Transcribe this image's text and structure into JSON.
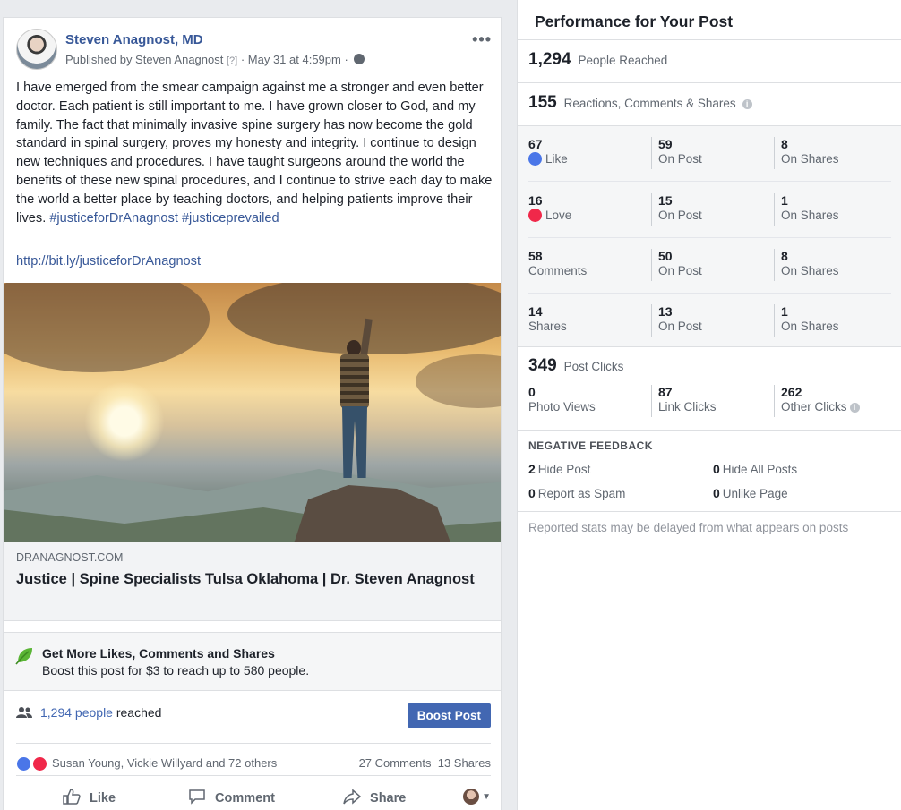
{
  "post": {
    "author": "Steven Anagnost, MD",
    "published_prefix": "Published by Steven Anagnost",
    "published_help": "[?]",
    "published_date": "· May 31 at 4:59pm ·",
    "more_label": "•••",
    "body": "I have emerged from the smear campaign against me a stronger and even better doctor. Each patient is still important to me. I have grown closer to God, and my family. The fact that minimally invasive spine surgery has now become the gold standard in spinal surgery, proves my honesty and integrity. I continue to design new techniques and procedures. I have taught surgeons around the world the benefits of these new spinal procedures, and I continue to strive each day to make the world a better place by teaching doctors, and helping patients improve their lives.",
    "hashtags": "#justiceforDrAnagnost #justiceprevailed",
    "link_url": "http://bit.ly/justiceforDrAnagnost",
    "link_domain": "DRANAGNOST.COM",
    "link_title": "Justice | Spine Specialists Tulsa Oklahoma | Dr. Steven Anagnost",
    "boost_title": "Get More Likes, Comments and Shares",
    "boost_sub": "Boost this post for $3 to reach up to 580 people.",
    "reach_count": "1,294 people",
    "reach_suffix": "reached",
    "boost_button": "Boost Post",
    "reaction_names": "Susan Young, Vickie Willyard and 72 others",
    "comments_count": "27 Comments",
    "shares_count": "13 Shares",
    "actions": {
      "like": "Like",
      "comment": "Comment",
      "share": "Share"
    }
  },
  "panel": {
    "title": "Performance for Your Post",
    "people_reached": {
      "num": "1,294",
      "label": "People Reached"
    },
    "engagement": {
      "num": "155",
      "label": "Reactions, Comments & Shares"
    },
    "rows": [
      {
        "n1": "67",
        "l1": "Like",
        "n2": "59",
        "l2": "On Post",
        "n3": "8",
        "l3": "On Shares"
      },
      {
        "n1": "16",
        "l1": "Love",
        "n2": "15",
        "l2": "On Post",
        "n3": "1",
        "l3": "On Shares"
      },
      {
        "n1": "58",
        "l1": "Comments",
        "n2": "50",
        "l2": "On Post",
        "n3": "8",
        "l3": "On Shares"
      },
      {
        "n1": "14",
        "l1": "Shares",
        "n2": "13",
        "l2": "On Post",
        "n3": "1",
        "l3": "On Shares"
      }
    ],
    "post_clicks": {
      "num": "349",
      "label": "Post Clicks"
    },
    "clicks": [
      {
        "n": "0",
        "l": "Photo Views"
      },
      {
        "n": "87",
        "l": "Link Clicks"
      },
      {
        "n": "262",
        "l": "Other Clicks"
      }
    ],
    "negative_title": "NEGATIVE FEEDBACK",
    "negative": [
      {
        "n": "2",
        "l": "Hide Post"
      },
      {
        "n": "0",
        "l": "Hide All Posts"
      },
      {
        "n": "0",
        "l": "Report as Spam"
      },
      {
        "n": "0",
        "l": "Unlike Page"
      }
    ],
    "footnote": "Reported stats may be delayed from what appears on posts"
  },
  "colors": {
    "brand_blue": "#4267b2",
    "link_blue": "#385898",
    "love_red": "#f0284a",
    "like_blue": "#4a76e8"
  },
  "icons": [
    "globe-icon",
    "more-icon",
    "leaf-icon",
    "people-icon",
    "like-icon",
    "love-icon",
    "thumbs-up-icon",
    "comment-icon",
    "share-icon",
    "info-icon",
    "caret-down-icon"
  ]
}
